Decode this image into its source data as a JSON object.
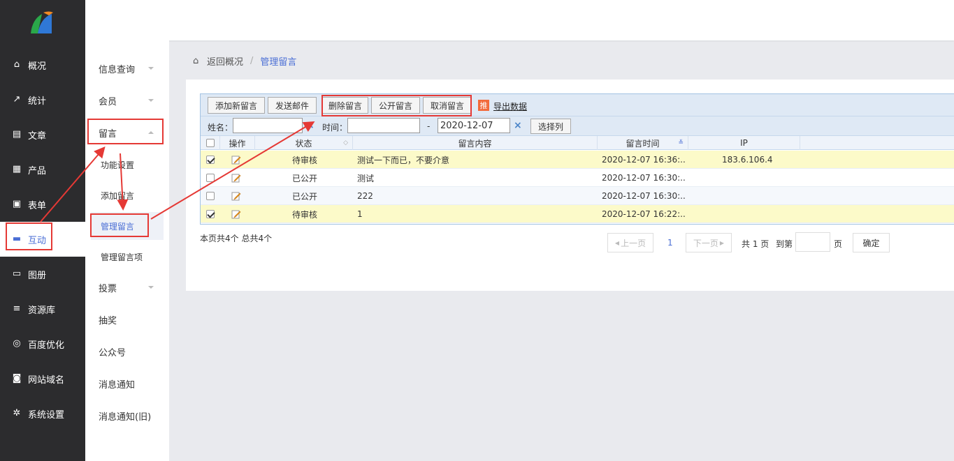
{
  "sidebar": {
    "items": [
      {
        "label": "概况",
        "icon": "home-icon"
      },
      {
        "label": "统计",
        "icon": "chart-icon"
      },
      {
        "label": "文章",
        "icon": "article-icon"
      },
      {
        "label": "产品",
        "icon": "product-icon"
      },
      {
        "label": "表单",
        "icon": "form-icon"
      },
      {
        "label": "互动",
        "icon": "chat-icon"
      },
      {
        "label": "图册",
        "icon": "album-icon"
      },
      {
        "label": "资源库",
        "icon": "database-icon"
      },
      {
        "label": "百度优化",
        "icon": "seo-icon"
      },
      {
        "label": "网站域名",
        "icon": "domain-icon"
      },
      {
        "label": "系统设置",
        "icon": "gear-icon"
      }
    ],
    "active": "互动"
  },
  "subnav": {
    "items": [
      "信息查询",
      "会员",
      "留言",
      "功能设置",
      "添加留言",
      "管理留言",
      "管理留言项",
      "投票",
      "抽奖",
      "公众号",
      "消息通知",
      "消息通知(旧)"
    ]
  },
  "breadcrumb": {
    "back": "返回概况",
    "separator": "/",
    "current": "管理留言"
  },
  "toolbar": {
    "add": "添加新留言",
    "email": "发送邮件",
    "delete": "删除留言",
    "publish": "公开留言",
    "cancel": "取消留言",
    "badge": "推",
    "export": "导出数据"
  },
  "filter": {
    "name_label": "姓名：",
    "name_value": "",
    "time_label": "时间：",
    "time_from": "",
    "dash": "-",
    "time_to": "2020-12-07",
    "clear": "×",
    "columns_button": "选择列"
  },
  "table": {
    "headers": [
      "操作",
      "状态",
      "留言内容",
      "留言时间",
      "IP"
    ],
    "rows": [
      {
        "checked": true,
        "status": "待审核",
        "content": "测试一下而已，不要介意",
        "time": "2020-12-07 16:36:...",
        "ip": "183.6.106.4"
      },
      {
        "checked": false,
        "status": "已公开",
        "content": "测试",
        "time": "2020-12-07 16:30:...",
        "ip": ""
      },
      {
        "checked": false,
        "status": "已公开",
        "content": "222",
        "time": "2020-12-07 16:30:...",
        "ip": ""
      },
      {
        "checked": true,
        "status": "待审核",
        "content": "1",
        "time": "2020-12-07 16:22:...",
        "ip": ""
      }
    ]
  },
  "pager": {
    "info": "本页共4个 总共4个",
    "prev": "上一页",
    "page": "1",
    "next": "下一页",
    "total": "共 1 页",
    "goto": "到第",
    "page_unit": "页",
    "goto_value": "",
    "confirm": "确定"
  },
  "colors": {
    "accent": "#4a6ed5",
    "annotation": "#e53935",
    "sidebar_bg": "#2c2c2e"
  }
}
